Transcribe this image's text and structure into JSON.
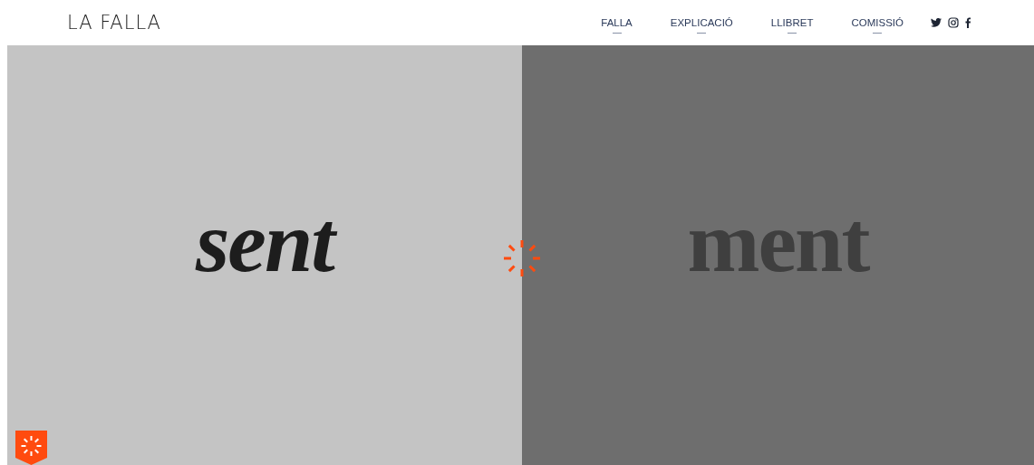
{
  "logo": "LA FALLA",
  "nav": [
    {
      "label": "FALLA"
    },
    {
      "label": "EXPLICACIÓ"
    },
    {
      "label": "LLIBRET"
    },
    {
      "label": "COMISSIÓ"
    }
  ],
  "social": [
    {
      "kind": "twitter"
    },
    {
      "kind": "instagram"
    },
    {
      "kind": "facebook"
    }
  ],
  "panels": [
    {
      "word": "sent",
      "kind": "italic"
    },
    {
      "word": "ment",
      "kind": "roman"
    }
  ]
}
